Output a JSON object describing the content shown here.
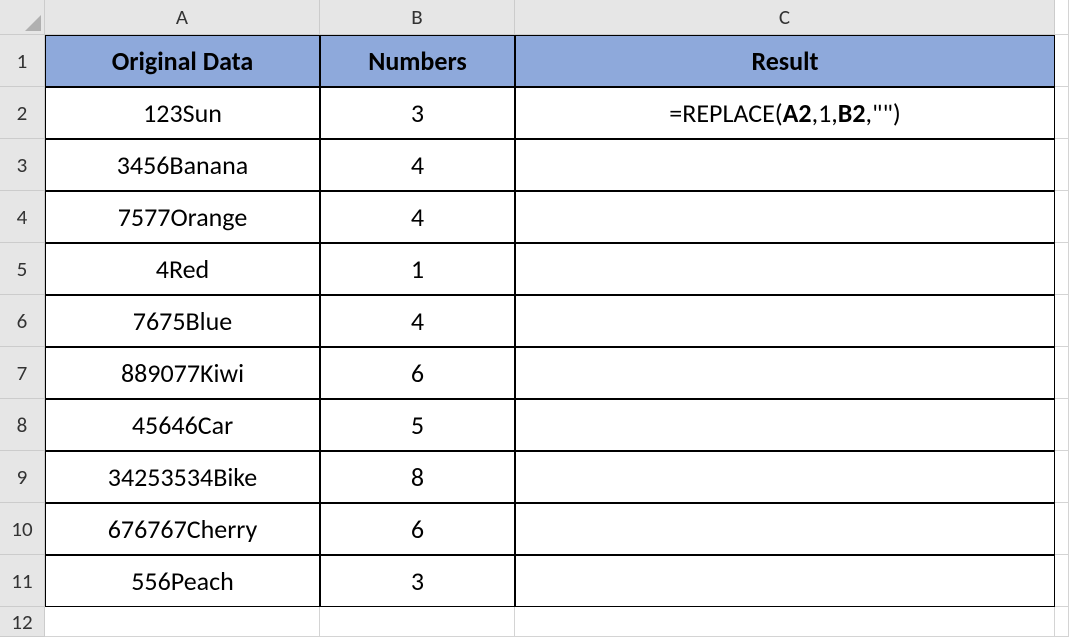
{
  "columns": [
    "A",
    "B",
    "C"
  ],
  "rowNumbers": [
    "1",
    "2",
    "3",
    "4",
    "5",
    "6",
    "7",
    "8",
    "9",
    "10",
    "11",
    "12"
  ],
  "headers": {
    "A": "Original Data",
    "B": "Numbers",
    "C": "Result"
  },
  "formula": {
    "prefix": "=REPLACE(",
    "ref1": "A2",
    "mid": ",1,",
    "ref2": "B2",
    "suffix": ",\"\")"
  },
  "rows": [
    {
      "A": "123Sun",
      "B": "3"
    },
    {
      "A": "3456Banana",
      "B": "4"
    },
    {
      "A": "7577Orange",
      "B": "4"
    },
    {
      "A": "4Red",
      "B": "1"
    },
    {
      "A": "7675Blue",
      "B": "4"
    },
    {
      "A": "889077Kiwi",
      "B": "6"
    },
    {
      "A": "45646Car",
      "B": "5"
    },
    {
      "A": "34253534Bike",
      "B": "8"
    },
    {
      "A": "676767Cherry",
      "B": "6"
    },
    {
      "A": "556Peach",
      "B": "3"
    }
  ]
}
